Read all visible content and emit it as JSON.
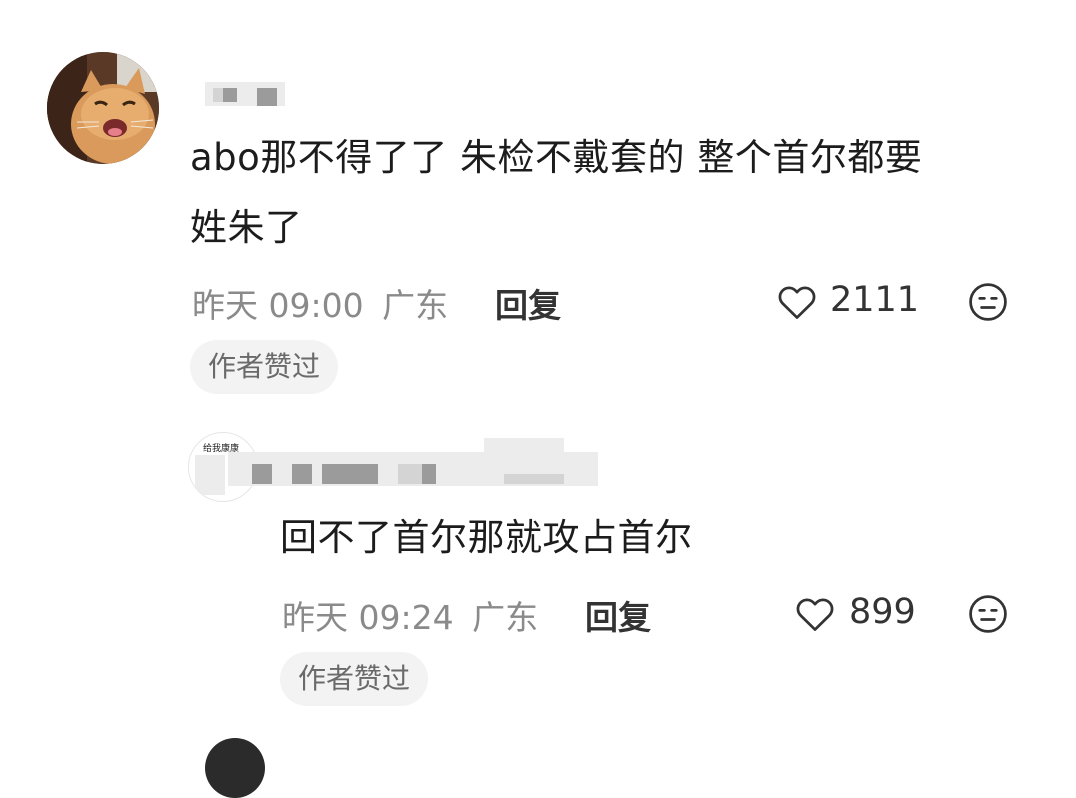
{
  "comments": [
    {
      "text_line1": "abo那不得了了 朱检不戴套的 整个首尔都要",
      "text_line2": "姓朱了",
      "time": "昨天 09:00",
      "location": "广东",
      "reply_label": "回复",
      "likes": "2111",
      "author_tag": "作者赞过"
    },
    {
      "avatar_text": "给我康康",
      "text_line1": "回不了首尔那就攻占首尔",
      "time": "昨天 09:24",
      "location": "广东",
      "reply_label": "回复",
      "likes": "899",
      "author_tag": "作者赞过"
    }
  ],
  "icons": {
    "like": "heart-outline-icon",
    "dislike": "meh-face-icon"
  },
  "colors": {
    "text": "#1c1c1c",
    "meta": "#8a8a8a",
    "tag_bg": "#f3f3f3"
  }
}
